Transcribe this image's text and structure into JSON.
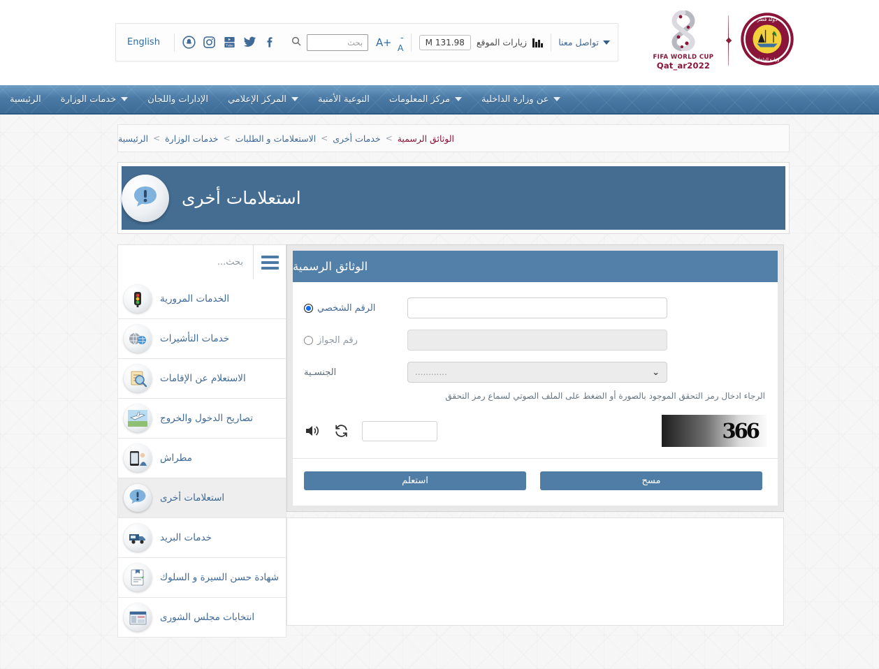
{
  "topbar": {
    "language_link": "English",
    "social": [
      {
        "name": "snapchat-icon",
        "label": "Snapchat"
      },
      {
        "name": "instagram-icon",
        "label": "Instagram"
      },
      {
        "name": "youtube-icon",
        "label": "YouTube"
      },
      {
        "name": "twitter-icon",
        "label": "Twitter"
      },
      {
        "name": "facebook-icon",
        "label": "Facebook"
      }
    ],
    "search_placeholder": "بحث",
    "font_increase": "+A",
    "font_decrease": "-A",
    "visits_count": "131.98 M",
    "visits_label": "زيارات الموقع",
    "contact_label": "تواصل معنا"
  },
  "logos": {
    "emblem_alt": "دولة قطر - وزارة الداخلية",
    "worldcup_title": "FIFA WORLD CUP",
    "worldcup_sub": "Qat_ar2022"
  },
  "nav": {
    "items": [
      {
        "label": "الرئيسية",
        "has_caret": false
      },
      {
        "label": "خدمات الوزارة",
        "has_caret": true
      },
      {
        "label": "الإدارات واللجان",
        "has_caret": false
      },
      {
        "label": "المركز الإعلامي",
        "has_caret": true
      },
      {
        "label": "التوعية الأمنية",
        "has_caret": false
      },
      {
        "label": "مركز المعلومات",
        "has_caret": true
      },
      {
        "label": "عن وزارة الداخلية",
        "has_caret": true
      }
    ]
  },
  "breadcrumb": {
    "separator": ">",
    "items": [
      {
        "label": "الرئيسية",
        "current": false
      },
      {
        "label": "خدمات الوزارة",
        "current": false
      },
      {
        "label": "الاستعلامات و الطلبات",
        "current": false
      },
      {
        "label": "خدمات أخرى",
        "current": false
      },
      {
        "label": "الوثائق الرسمية",
        "current": true
      }
    ]
  },
  "banner": {
    "title": "استعلامات أخرى",
    "icon": "exclamation-speech-bubble-icon"
  },
  "sidebar": {
    "search_placeholder": "بحث...",
    "menu_icon": "hamburger-menu-icon",
    "items": [
      {
        "label": "الخدمات المرورية",
        "icon": "traffic-light-icon",
        "active": false
      },
      {
        "label": "خدمات التأشيرات",
        "icon": "visa-globe-icon",
        "active": false
      },
      {
        "label": "الاستعلام عن الإقامات",
        "icon": "magnifier-document-icon",
        "active": false
      },
      {
        "label": "تصاريح الدخول والخروج",
        "icon": "airplane-icon",
        "active": false
      },
      {
        "label": "مطراش",
        "icon": "mobile-app-icon",
        "active": false
      },
      {
        "label": "استعلامات أخرى",
        "icon": "exclamation-speech-bubble-icon",
        "active": true
      },
      {
        "label": "خدمات البريد",
        "icon": "delivery-van-icon",
        "active": false
      },
      {
        "label": "شهادة حسن السيرة و السلوك",
        "icon": "certificate-icon",
        "active": false
      },
      {
        "label": "انتخابات مجلس الشورى",
        "icon": "ballot-icon",
        "active": false
      }
    ]
  },
  "form": {
    "title": "الوثائق الرسمية",
    "personal_id_label": "الرقم الشخصي",
    "personal_id_selected": true,
    "personal_id_value": "",
    "passport_label": "رقم الجواز",
    "passport_selected": false,
    "passport_value": "",
    "nationality_label": "الجنسـية",
    "nationality_value": "............",
    "nationality_chevron": "⌄",
    "captcha_hint": "الرجاء ادخال رمز التحقق الموجود بالصورة أو الضغط على الملف الصوتي لسماع رمز التحقق",
    "captcha_text": "366",
    "captcha_input_value": "",
    "audio_icon": "speaker-icon",
    "refresh_icon": "refresh-icon",
    "submit_label": "استعلم",
    "clear_label": "مسح"
  },
  "colors": {
    "accent_blue": "#4f7da5",
    "panel_header": "#5280a8",
    "banner_bg": "#456d92",
    "link_blue": "#3f6996",
    "crumb_current": "#8a1538",
    "radio_selected": "#0c6cf2"
  }
}
